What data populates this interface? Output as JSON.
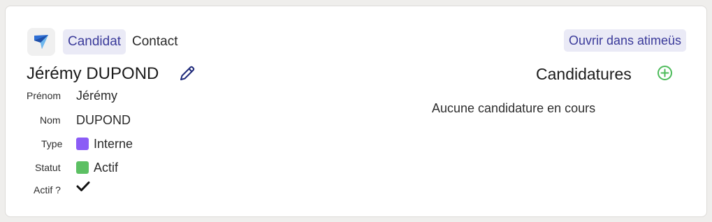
{
  "header": {
    "logo_icon": "atimeus-logo-icon",
    "tabs": [
      {
        "label": "Candidat",
        "active": true
      },
      {
        "label": "Contact",
        "active": false
      }
    ],
    "open_button_label": "Ouvrir dans atimeüs"
  },
  "person": {
    "full_name": "Jérémy DUPOND",
    "edit_icon": "pencil-icon",
    "fields": {
      "prenom": {
        "label": "Prénom",
        "value": "Jérémy"
      },
      "nom": {
        "label": "Nom",
        "value": "DUPOND"
      },
      "type": {
        "label": "Type",
        "value": "Interne",
        "color": "#8b5cf6"
      },
      "statut": {
        "label": "Statut",
        "value": "Actif",
        "color": "#5cc063"
      },
      "actif": {
        "label": "Actif ?",
        "checked": true,
        "icon": "checkmark-icon"
      }
    }
  },
  "candidatures": {
    "title": "Candidatures",
    "add_icon": "plus-circle-icon",
    "add_color": "#4cbb5a",
    "empty_text": "Aucune candidature en cours"
  }
}
